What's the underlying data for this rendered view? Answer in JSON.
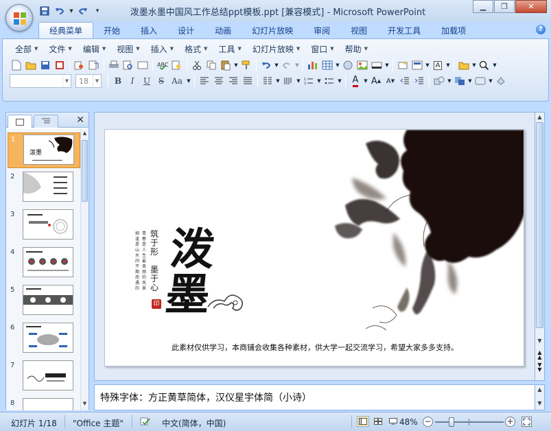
{
  "window": {
    "title": "泼墨水墨中国风工作总结ppt模板.ppt [兼容模式] - Microsoft PowerPoint",
    "minimize_icon": "minimize-icon",
    "maximize_icon": "maximize-icon",
    "close_icon": "close-icon"
  },
  "quick_access": {
    "items": [
      "save-icon",
      "undo-icon",
      "redo-icon",
      "customize-icon"
    ]
  },
  "ribbon_tabs": [
    "经典菜单",
    "开始",
    "插入",
    "设计",
    "动画",
    "幻灯片放映",
    "审阅",
    "视图",
    "开发工具",
    "加载项"
  ],
  "active_tab": "经典菜单",
  "classic_menus": [
    "全部",
    "文件",
    "编辑",
    "视图",
    "插入",
    "格式",
    "工具",
    "幻灯片放映",
    "窗口",
    "帮助"
  ],
  "toolbar": {
    "font_name": "",
    "font_size": "18",
    "bold": "B",
    "italic": "I",
    "underline": "U",
    "strike": "S",
    "case": "Aa",
    "font_color_glyph": "A",
    "grow_font": "A",
    "shrink_font": "A",
    "textbox_glyph": "A"
  },
  "left_pane": {
    "tab_slides_icon": "slides-tab-icon",
    "tab_outline_icon": "outline-tab-icon",
    "close_glyph": "✕",
    "slides": [
      {
        "number": "1",
        "selected": true
      },
      {
        "number": "2",
        "selected": false
      },
      {
        "number": "3",
        "selected": false
      },
      {
        "number": "4",
        "selected": false
      },
      {
        "number": "5",
        "selected": false
      },
      {
        "number": "6",
        "selected": false
      },
      {
        "number": "7",
        "selected": false
      },
      {
        "number": "8",
        "selected": false
      }
    ]
  },
  "slide": {
    "title_char1": "泼",
    "title_char2": "墨",
    "author_line1": "筑于形",
    "author_line2": "墨于心",
    "seal_text": "印",
    "poem_col1": "青春是人生最美丽的风景",
    "poem_col2": "相逢是山水间不期而遇的",
    "caption": "此素材仅供学习，本商铺会收集各种素材，供大学一起交流学习，希望大家多多支持。"
  },
  "notes": {
    "text": "特殊字体：方正黄草简体，汉仪星宇体简（小诗）"
  },
  "status_bar": {
    "slide_info": "幻灯片 1/18",
    "theme": "\"Office 主题\"",
    "language": "中文(简体，中国)",
    "zoom": "48%",
    "zoom_fraction": 0.48
  },
  "colors": {
    "ribbon_border": "#8db2e3",
    "selected_thumb": "#f5b45d",
    "ink": "#1a0e0a"
  }
}
